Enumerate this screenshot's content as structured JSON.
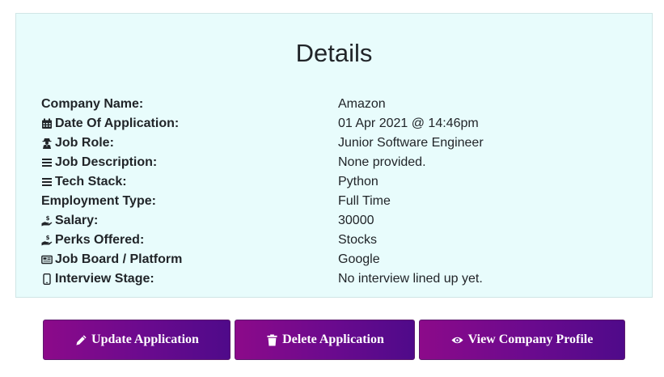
{
  "details": {
    "title": "Details",
    "rows": [
      {
        "label": "Company Name:",
        "value": "Amazon",
        "icon": ""
      },
      {
        "label": "Date Of Application:",
        "value": "01 Apr 2021 @ 14:46pm",
        "icon": "calendar-icon"
      },
      {
        "label": "Job Role:",
        "value": "Junior Software Engineer",
        "icon": "user-secret-icon"
      },
      {
        "label": "Job Description:",
        "value": "None provided.",
        "icon": "bars-icon"
      },
      {
        "label": "Tech Stack:",
        "value": "Python",
        "icon": "bars-icon"
      },
      {
        "label": "Employment Type:",
        "value": "Full Time",
        "icon": ""
      },
      {
        "label": "Salary:",
        "value": "30000",
        "icon": "hand-holding-usd-icon"
      },
      {
        "label": "Perks Offered:",
        "value": "Stocks",
        "icon": "hand-holding-usd-icon"
      },
      {
        "label": "Job Board / Platform",
        "value": "Google",
        "icon": "newspaper-icon"
      },
      {
        "label": "Interview Stage:",
        "value": "No interview lined up yet.",
        "icon": "mobile-icon"
      }
    ]
  },
  "actions": {
    "update_label": "Update Application",
    "delete_label": "Delete Application",
    "profile_label": "View Company Profile"
  },
  "colors": {
    "card_background": "#e8fcfc",
    "button_gradient_start": "#8c0a8a",
    "button_gradient_end": "#4f0a8a"
  }
}
